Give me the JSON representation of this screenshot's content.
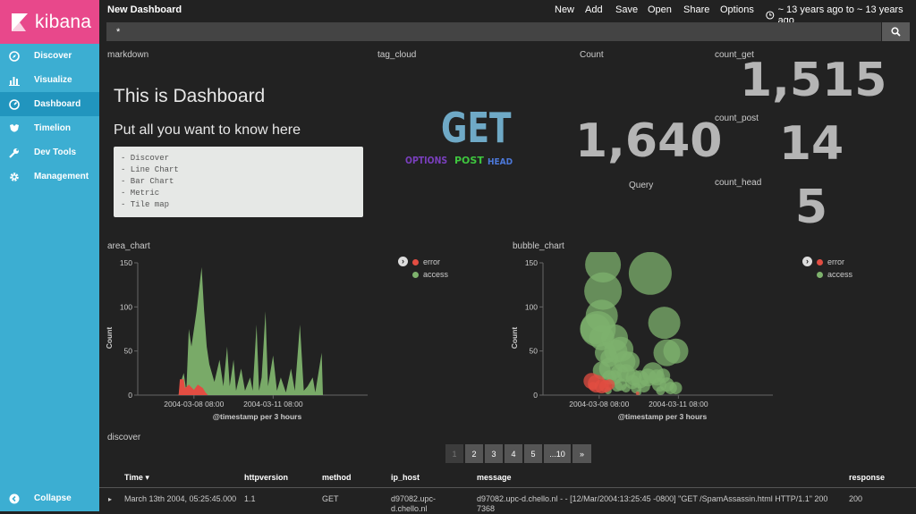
{
  "app": {
    "logo_text": "kibana"
  },
  "sidebar": {
    "items": [
      {
        "label": "Discover",
        "icon": "compass-icon"
      },
      {
        "label": "Visualize",
        "icon": "bar-chart-icon"
      },
      {
        "label": "Dashboard",
        "icon": "dashboard-icon",
        "active": true
      },
      {
        "label": "Timelion",
        "icon": "timelion-icon"
      },
      {
        "label": "Dev Tools",
        "icon": "wrench-icon"
      },
      {
        "label": "Management",
        "icon": "gear-icon"
      }
    ],
    "collapse_label": "Collapse"
  },
  "topbar": {
    "title": "New Dashboard",
    "new": "New",
    "add": "Add",
    "save": "Save",
    "open": "Open",
    "share": "Share",
    "options": "Options",
    "time_range": "~ 13 years ago to ~ 13 years ago"
  },
  "search": {
    "value": "*"
  },
  "panels": {
    "markdown": {
      "title": "markdown",
      "heading": "This is Dashboard",
      "subheading": "Put all you want to know here",
      "list": [
        "- Discover",
        "- Line Chart",
        "- Bar Chart",
        "- Metric",
        "- Tile map"
      ]
    },
    "tag_cloud": {
      "title": "tag_cloud",
      "tags": [
        {
          "text": "GET",
          "color": "#6fa9c6"
        },
        {
          "text": "OPTIONS",
          "color": "#7a3fbe"
        },
        {
          "text": "POST",
          "color": "#3ec63e"
        },
        {
          "text": "HEAD",
          "color": "#4c78d8"
        }
      ]
    },
    "count": {
      "title": "Count",
      "value": "1,640",
      "label": "Query"
    },
    "count_get": {
      "title": "count_get",
      "value": "1,515"
    },
    "count_post": {
      "title": "count_post",
      "value": "14"
    },
    "count_head": {
      "title": "count_head",
      "value": "5"
    },
    "area_chart": {
      "title": "area_chart"
    },
    "bubble_chart": {
      "title": "bubble_chart"
    },
    "discover": {
      "title": "discover"
    }
  },
  "colors": {
    "error": "#e24d42",
    "access": "#7eb26d"
  },
  "chart_data": [
    {
      "type": "area",
      "title": "area_chart",
      "xlabel": "@timestamp per 3 hours",
      "ylabel": "Count",
      "ylim": [
        0,
        150
      ],
      "y_ticks": [
        0,
        50,
        100,
        150
      ],
      "x_ticks": [
        {
          "value": 2.2,
          "label": "2004-03-08 08:00"
        },
        {
          "value": 5.3,
          "label": "2004-03-11 08:00"
        }
      ],
      "x_range": [
        0,
        9.0
      ],
      "legend": [
        "error",
        "access"
      ],
      "legend_position": "right",
      "series": [
        {
          "name": "access",
          "color": "#7eb26d",
          "points": [
            [
              1.6,
              0
            ],
            [
              1.65,
              12
            ],
            [
              1.8,
              25
            ],
            [
              1.9,
              5
            ],
            [
              2.0,
              75
            ],
            [
              2.1,
              55
            ],
            [
              2.3,
              95
            ],
            [
              2.5,
              145
            ],
            [
              2.6,
              95
            ],
            [
              2.7,
              55
            ],
            [
              2.8,
              35
            ],
            [
              2.9,
              25
            ],
            [
              3.0,
              15
            ],
            [
              3.2,
              40
            ],
            [
              3.35,
              10
            ],
            [
              3.5,
              55
            ],
            [
              3.6,
              10
            ],
            [
              3.75,
              40
            ],
            [
              3.85,
              5
            ],
            [
              4.05,
              30
            ],
            [
              4.2,
              5
            ],
            [
              4.4,
              20
            ],
            [
              4.5,
              5
            ],
            [
              4.65,
              80
            ],
            [
              4.75,
              5
            ],
            [
              4.85,
              20
            ],
            [
              5.0,
              95
            ],
            [
              5.1,
              10
            ],
            [
              5.3,
              45
            ],
            [
              5.45,
              5
            ],
            [
              5.6,
              20
            ],
            [
              5.8,
              3
            ],
            [
              6.0,
              30
            ],
            [
              6.15,
              5
            ],
            [
              6.35,
              80
            ],
            [
              6.5,
              5
            ],
            [
              6.65,
              10
            ],
            [
              6.85,
              20
            ],
            [
              6.95,
              3
            ],
            [
              7.2,
              48
            ],
            [
              7.25,
              0
            ]
          ]
        },
        {
          "name": "error",
          "color": "#e24d42",
          "points": [
            [
              1.6,
              0
            ],
            [
              1.65,
              18
            ],
            [
              1.8,
              18
            ],
            [
              1.85,
              8
            ],
            [
              2.0,
              12
            ],
            [
              2.2,
              6
            ],
            [
              2.35,
              12
            ],
            [
              2.55,
              8
            ],
            [
              2.65,
              3
            ],
            [
              2.75,
              0
            ]
          ]
        }
      ]
    },
    {
      "type": "scatter",
      "title": "bubble_chart",
      "xlabel": "@timestamp per 3 hours",
      "ylabel": "Count",
      "ylim": [
        0,
        150
      ],
      "y_ticks": [
        0,
        50,
        100,
        150
      ],
      "x_ticks": [
        {
          "value": 2.2,
          "label": "2004-03-08 08:00"
        },
        {
          "value": 5.3,
          "label": "2004-03-11 08:00"
        }
      ],
      "x_range": [
        0,
        9.0
      ],
      "legend": [
        "error",
        "access"
      ],
      "legend_position": "right",
      "series": [
        {
          "name": "access",
          "color": "#7eb26d",
          "points": [
            [
              2.35,
              148,
              20
            ],
            [
              2.35,
              118,
              21
            ],
            [
              2.3,
              90,
              18
            ],
            [
              2.15,
              75,
              20
            ],
            [
              2.05,
              75,
              17
            ],
            [
              2.3,
              65,
              14
            ],
            [
              2.8,
              65,
              15
            ],
            [
              2.85,
              50,
              13
            ],
            [
              3.05,
              52,
              14
            ],
            [
              2.45,
              48,
              12
            ],
            [
              2.6,
              42,
              10
            ],
            [
              2.65,
              30,
              13
            ],
            [
              3.2,
              38,
              12
            ],
            [
              3.4,
              38,
              11
            ],
            [
              3.25,
              25,
              10
            ],
            [
              3.0,
              25,
              10
            ],
            [
              2.8,
              20,
              8
            ],
            [
              3.55,
              20,
              9
            ],
            [
              3.8,
              18,
              10
            ],
            [
              4.2,
              138,
              24
            ],
            [
              4.75,
              82,
              18
            ],
            [
              4.85,
              48,
              15
            ],
            [
              5.2,
              50,
              14
            ],
            [
              4.3,
              25,
              12
            ],
            [
              4.1,
              20,
              10
            ],
            [
              4.45,
              20,
              9
            ],
            [
              4.55,
              12,
              8
            ],
            [
              4.85,
              12,
              8
            ],
            [
              5.0,
              8,
              7
            ],
            [
              5.2,
              8,
              7
            ],
            [
              3.05,
              12,
              7
            ],
            [
              3.5,
              15,
              8
            ],
            [
              3.65,
              8,
              6
            ],
            [
              3.95,
              10,
              7
            ],
            [
              2.3,
              28,
              10
            ],
            [
              2.6,
              20,
              8
            ],
            [
              2.9,
              10,
              6
            ],
            [
              3.25,
              8,
              5
            ],
            [
              4.7,
              22,
              8
            ],
            [
              4.6,
              5,
              5
            ],
            [
              3.75,
              3,
              3
            ],
            [
              2.55,
              5,
              4
            ]
          ]
        },
        {
          "name": "error",
          "color": "#e24d42",
          "points": [
            [
              1.9,
              16,
              9
            ],
            [
              2.1,
              13,
              10
            ],
            [
              2.3,
              10,
              8
            ],
            [
              2.45,
              10,
              7
            ],
            [
              2.6,
              12,
              6
            ],
            [
              1.95,
              10,
              5
            ],
            [
              3.7,
              2,
              2
            ]
          ]
        }
      ]
    }
  ],
  "discover": {
    "pagination": [
      "1",
      "2",
      "3",
      "4",
      "5",
      "...10",
      "»"
    ],
    "columns": [
      "Time",
      "httpversion",
      "method",
      "ip_host",
      "message",
      "response"
    ],
    "rows": [
      {
        "time": "March 13th 2004, 05:25:45.000",
        "httpversion": "1.1",
        "method": "GET",
        "ip_host": "d97082.upc-d.chello.nl",
        "message": "d97082.upc-d.chello.nl - - [12/Mar/2004:13:25:45 -0800] \"GET /SpamAssassin.html HTTP/1.1\" 200 7368",
        "response": "200"
      }
    ]
  }
}
